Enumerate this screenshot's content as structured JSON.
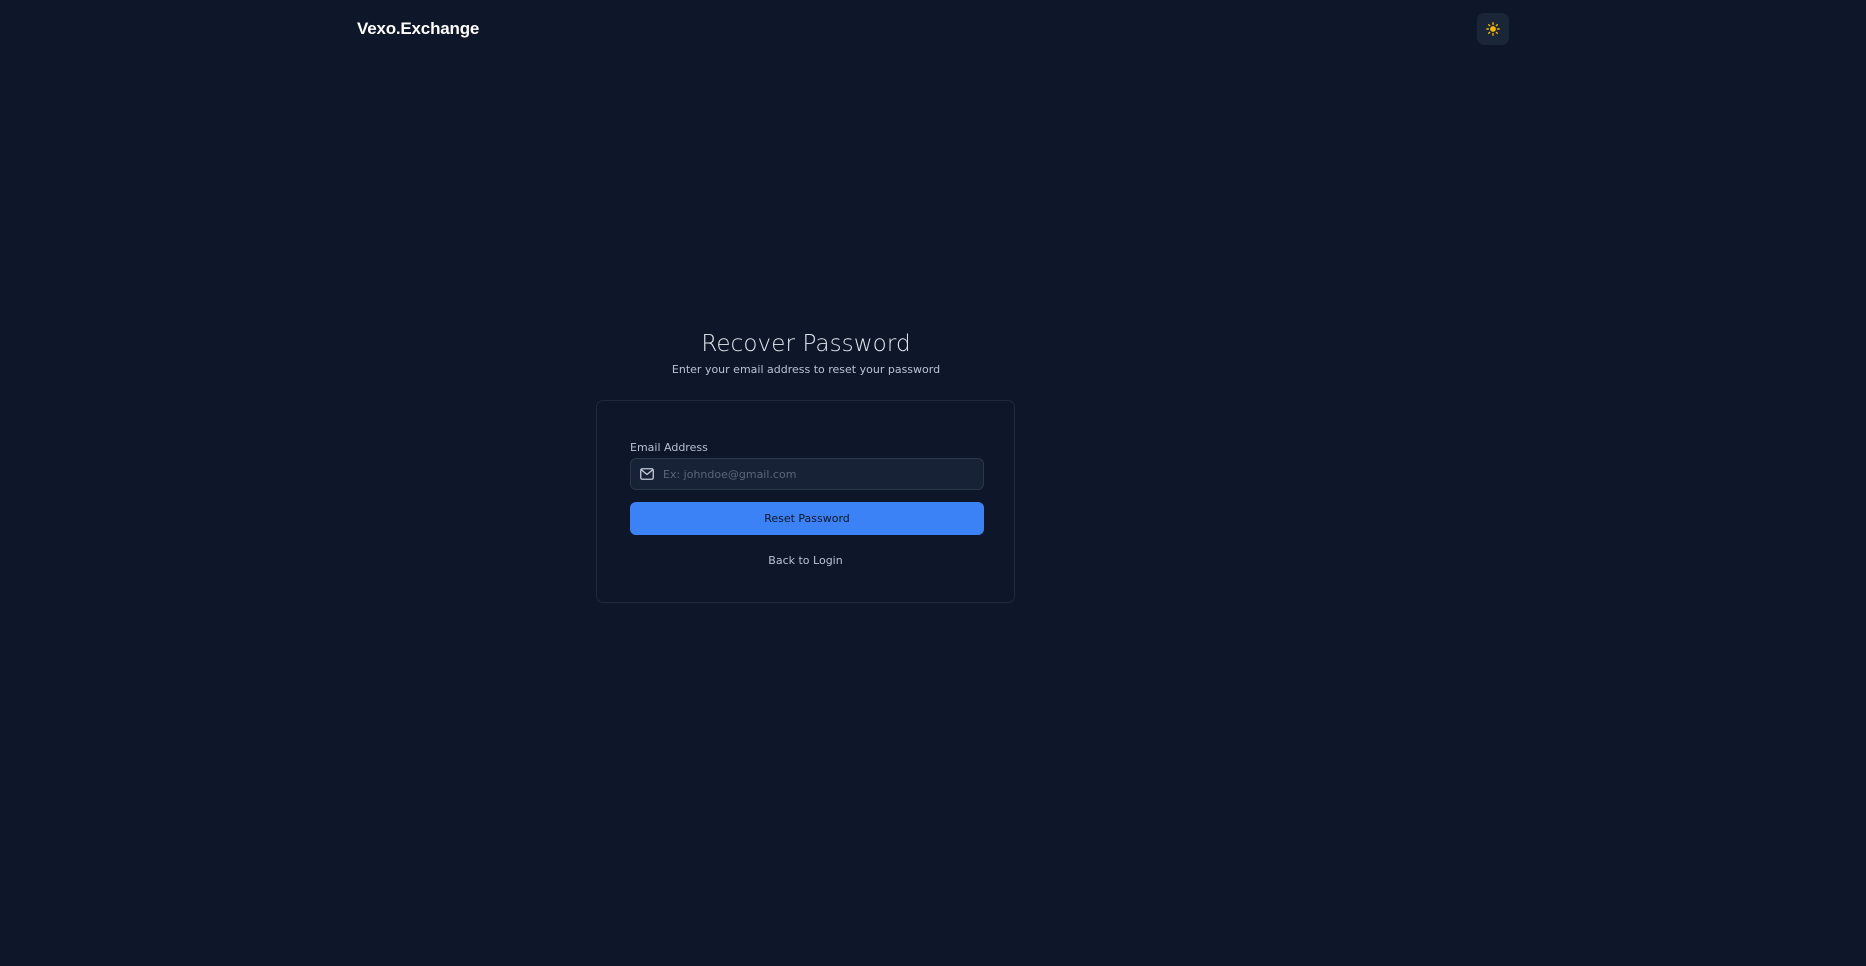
{
  "header": {
    "brand": "Vexo.Exchange",
    "theme_toggle_icon": "sun-icon",
    "theme_icon_color": "#f5b700"
  },
  "main": {
    "title": "Recover Password",
    "subtitle": "Enter your email address to reset your password"
  },
  "form": {
    "email_label": "Email Address",
    "email_placeholder": "Ex: johndoe@gmail.com",
    "email_value": "",
    "email_icon": "mail-icon",
    "submit_label": "Reset Password",
    "back_link": "Back to Login"
  },
  "colors": {
    "background": "#0e1629",
    "accent": "#3b82f6"
  }
}
